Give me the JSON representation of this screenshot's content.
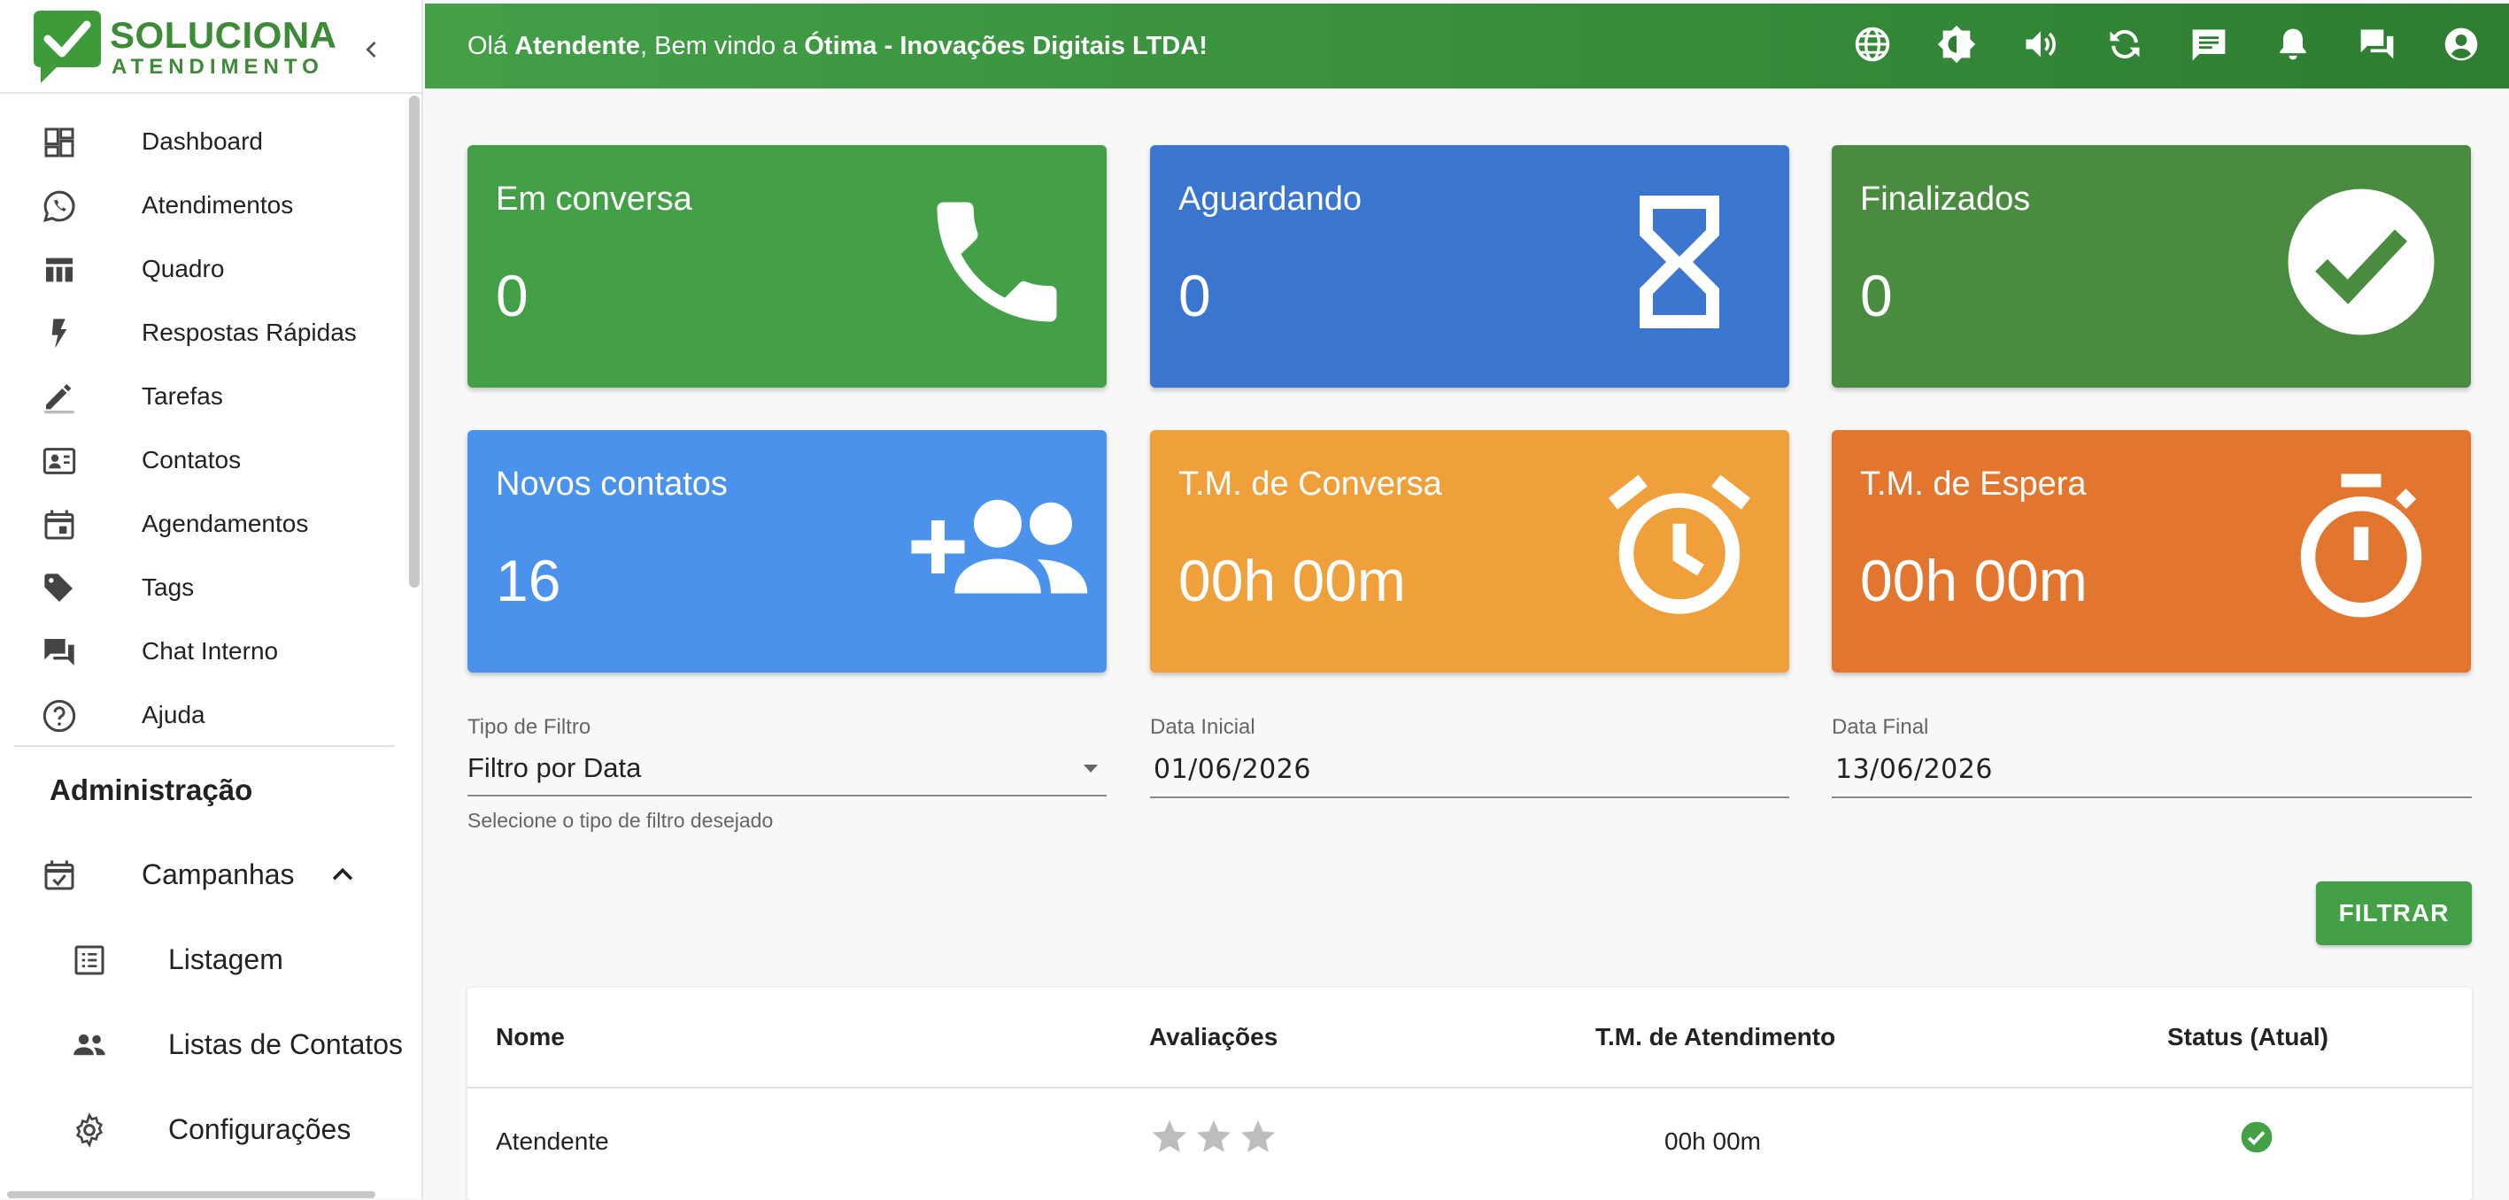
{
  "brand": {
    "title": "SOLUCIONA",
    "subtitle": "ATENDIMENTO",
    "color": "#3d8b37"
  },
  "header": {
    "greeting_prefix": "Olá ",
    "user": "Atendente",
    "greeting_mid": ", Bem vindo a ",
    "company": "Ótima - Inovações Digitais LTDA",
    "greeting_end": "!",
    "icons": [
      "globe-icon",
      "brightness-icon",
      "volume-icon",
      "refresh-icon",
      "message-icon",
      "bell-icon",
      "chat-icon",
      "account-icon"
    ]
  },
  "sidebar": {
    "items": [
      {
        "label": "Dashboard",
        "icon": "dashboard-icon"
      },
      {
        "label": "Atendimentos",
        "icon": "whatsapp-icon"
      },
      {
        "label": "Quadro",
        "icon": "board-icon"
      },
      {
        "label": "Respostas Rápidas",
        "icon": "bolt-icon"
      },
      {
        "label": "Tarefas",
        "icon": "pencil-icon"
      },
      {
        "label": "Contatos",
        "icon": "contact-card-icon"
      },
      {
        "label": "Agendamentos",
        "icon": "calendar-icon"
      },
      {
        "label": "Tags",
        "icon": "tag-icon"
      },
      {
        "label": "Chat Interno",
        "icon": "forum-icon"
      },
      {
        "label": "Ajuda",
        "icon": "help-icon"
      }
    ],
    "section_title": "Administração",
    "campaigns": {
      "label": "Campanhas",
      "icon": "event-check-icon"
    },
    "sub_items": [
      {
        "label": "Listagem",
        "icon": "list-icon"
      },
      {
        "label": "Listas de Contatos",
        "icon": "people-icon"
      },
      {
        "label": "Configurações",
        "icon": "settings-icon"
      }
    ]
  },
  "cards": [
    {
      "title": "Em conversa",
      "value": "0",
      "color": "#43a047",
      "icon": "phone-icon"
    },
    {
      "title": "Aguardando",
      "value": "0",
      "color": "#3a75cf",
      "icon": "hourglass-icon"
    },
    {
      "title": "Finalizados",
      "value": "0",
      "color": "#4a8c3f",
      "icon": "check-circle-icon"
    },
    {
      "title": "Novos contatos",
      "value": "16",
      "color": "#4a92eb",
      "icon": "add-group-icon"
    },
    {
      "title": "T.M. de Conversa",
      "value": "00h 00m",
      "color": "#f0a03a",
      "icon": "alarm-icon"
    },
    {
      "title": "T.M. de Espera",
      "value": "00h 00m",
      "color": "#e3762e",
      "icon": "timer-icon"
    }
  ],
  "filters": {
    "type_label": "Tipo de Filtro",
    "type_value": "Filtro por Data",
    "type_helper": "Selecione o tipo de filtro desejado",
    "start_label": "Data Inicial",
    "start_value": "01/06/2026",
    "end_label": "Data Final",
    "end_value": "13/06/2026",
    "button": "FILTRAR"
  },
  "table": {
    "headers": [
      "Nome",
      "Avaliações",
      "T.M. de Atendimento",
      "Status (Atual)"
    ],
    "rows": [
      {
        "name": "Atendente",
        "rating": 0,
        "rating_max": 3,
        "tm": "00h 00m",
        "status": "online"
      }
    ]
  }
}
